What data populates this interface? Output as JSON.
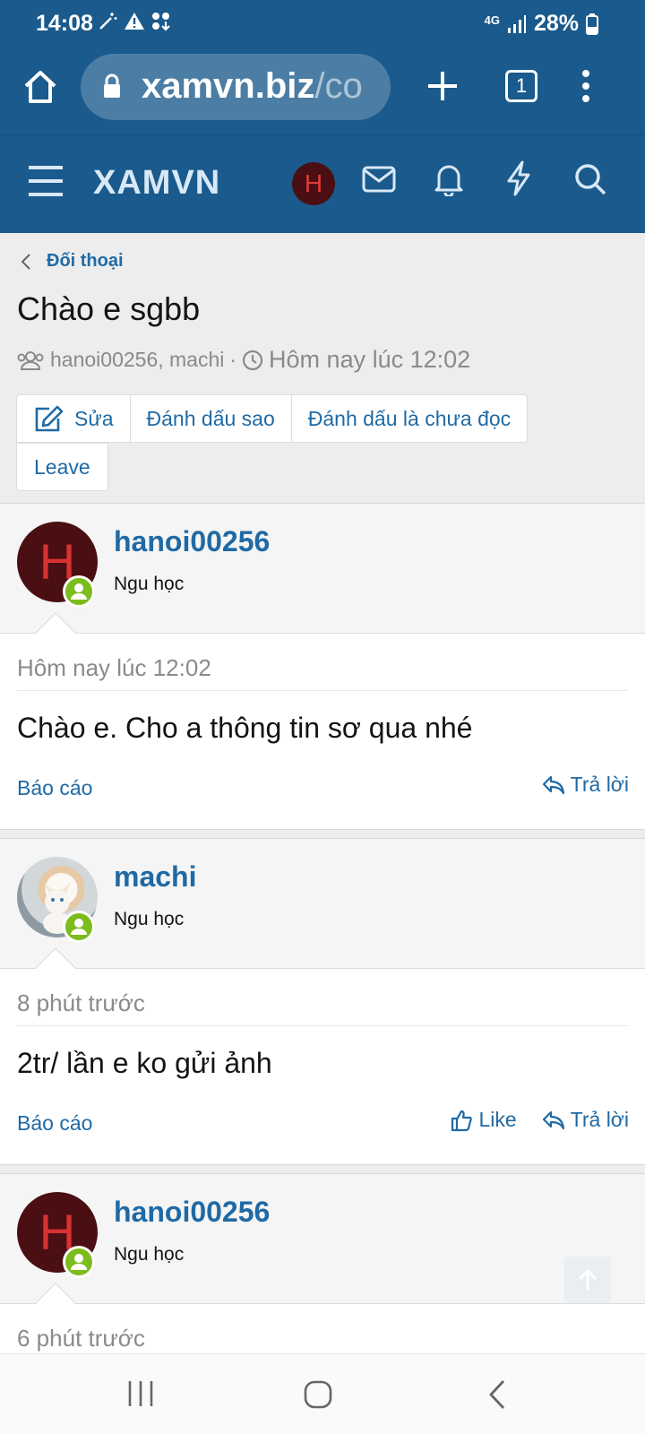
{
  "status_bar": {
    "time": "14:08",
    "network": "4G",
    "battery": "28%"
  },
  "browser": {
    "url_domain": "xamvn.biz",
    "url_path": "/co",
    "tab_count": "1"
  },
  "site": {
    "logo": "XAMVN",
    "user_initial": "H"
  },
  "conversation": {
    "breadcrumb": "Đối thoại",
    "title": "Chào e sgbb",
    "participants": "hanoi00256, machi",
    "separator": "·",
    "time": "Hôm nay lúc 12:02",
    "buttons": {
      "edit": "Sửa",
      "star": "Đánh dấu sao",
      "mark_unread": "Đánh dấu là chưa đọc",
      "leave": "Leave"
    }
  },
  "messages": [
    {
      "username": "hanoi00256",
      "initial": "H",
      "role": "Ngu học",
      "time": "Hôm nay lúc 12:02",
      "text": "Chào e. Cho a thông tin sơ qua nhé",
      "report": "Báo cáo",
      "reply": "Trả lời"
    },
    {
      "username": "machi",
      "role": "Ngu học",
      "time": "8 phút trước",
      "text": "2tr/ lần e ko gửi ảnh",
      "report": "Báo cáo",
      "like": "Like",
      "reply": "Trả lời"
    },
    {
      "username": "hanoi00256",
      "initial": "H",
      "role": "Ngu học",
      "time": "6 phút trước"
    }
  ],
  "colors": {
    "header_bg": "#1a5a8c",
    "link": "#1f6aa5",
    "online": "#7cbc1c",
    "avatar_bg": "#4a0f12"
  }
}
